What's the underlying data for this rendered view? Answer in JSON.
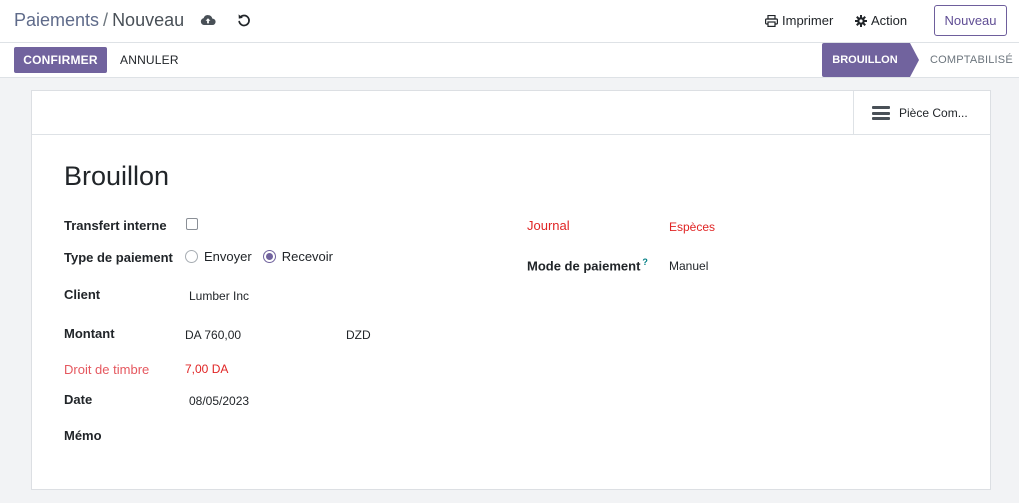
{
  "breadcrumb": {
    "parent": "Paiements",
    "separator": "/",
    "current": "Nouveau"
  },
  "header": {
    "print_label": "Imprimer",
    "action_label": "Action",
    "new_label": "Nouveau"
  },
  "toolbar": {
    "confirm_label": "CONFIRMER",
    "cancel_label": "ANNULER"
  },
  "statusbar": {
    "active": "BROUILLON",
    "next": "COMPTABILISÉ"
  },
  "smart_button": {
    "label": "Pièce Com..."
  },
  "form": {
    "title": "Brouillon",
    "internal_transfer": {
      "label": "Transfert interne",
      "checked": false
    },
    "payment_type": {
      "label": "Type de paiement",
      "options": [
        "Envoyer",
        "Recevoir"
      ],
      "selected": "Recevoir"
    },
    "partner": {
      "label": "Client",
      "value": "Lumber Inc"
    },
    "amount": {
      "label": "Montant",
      "value": "DA 760,00",
      "currency": "DZD"
    },
    "stamp_duty": {
      "label": "Droit de timbre",
      "value": "7,00 DA"
    },
    "date": {
      "label": "Date",
      "value": "08/05/2023"
    },
    "memo": {
      "label": "Mémo",
      "value": ""
    },
    "journal": {
      "label": "Journal",
      "value": "Espèces"
    },
    "payment_method": {
      "label": "Mode de paiement",
      "help": "?",
      "value": "Manuel"
    }
  },
  "colors": {
    "accent": "#71639e",
    "required": "#e02424",
    "warning": "#e5585f"
  }
}
